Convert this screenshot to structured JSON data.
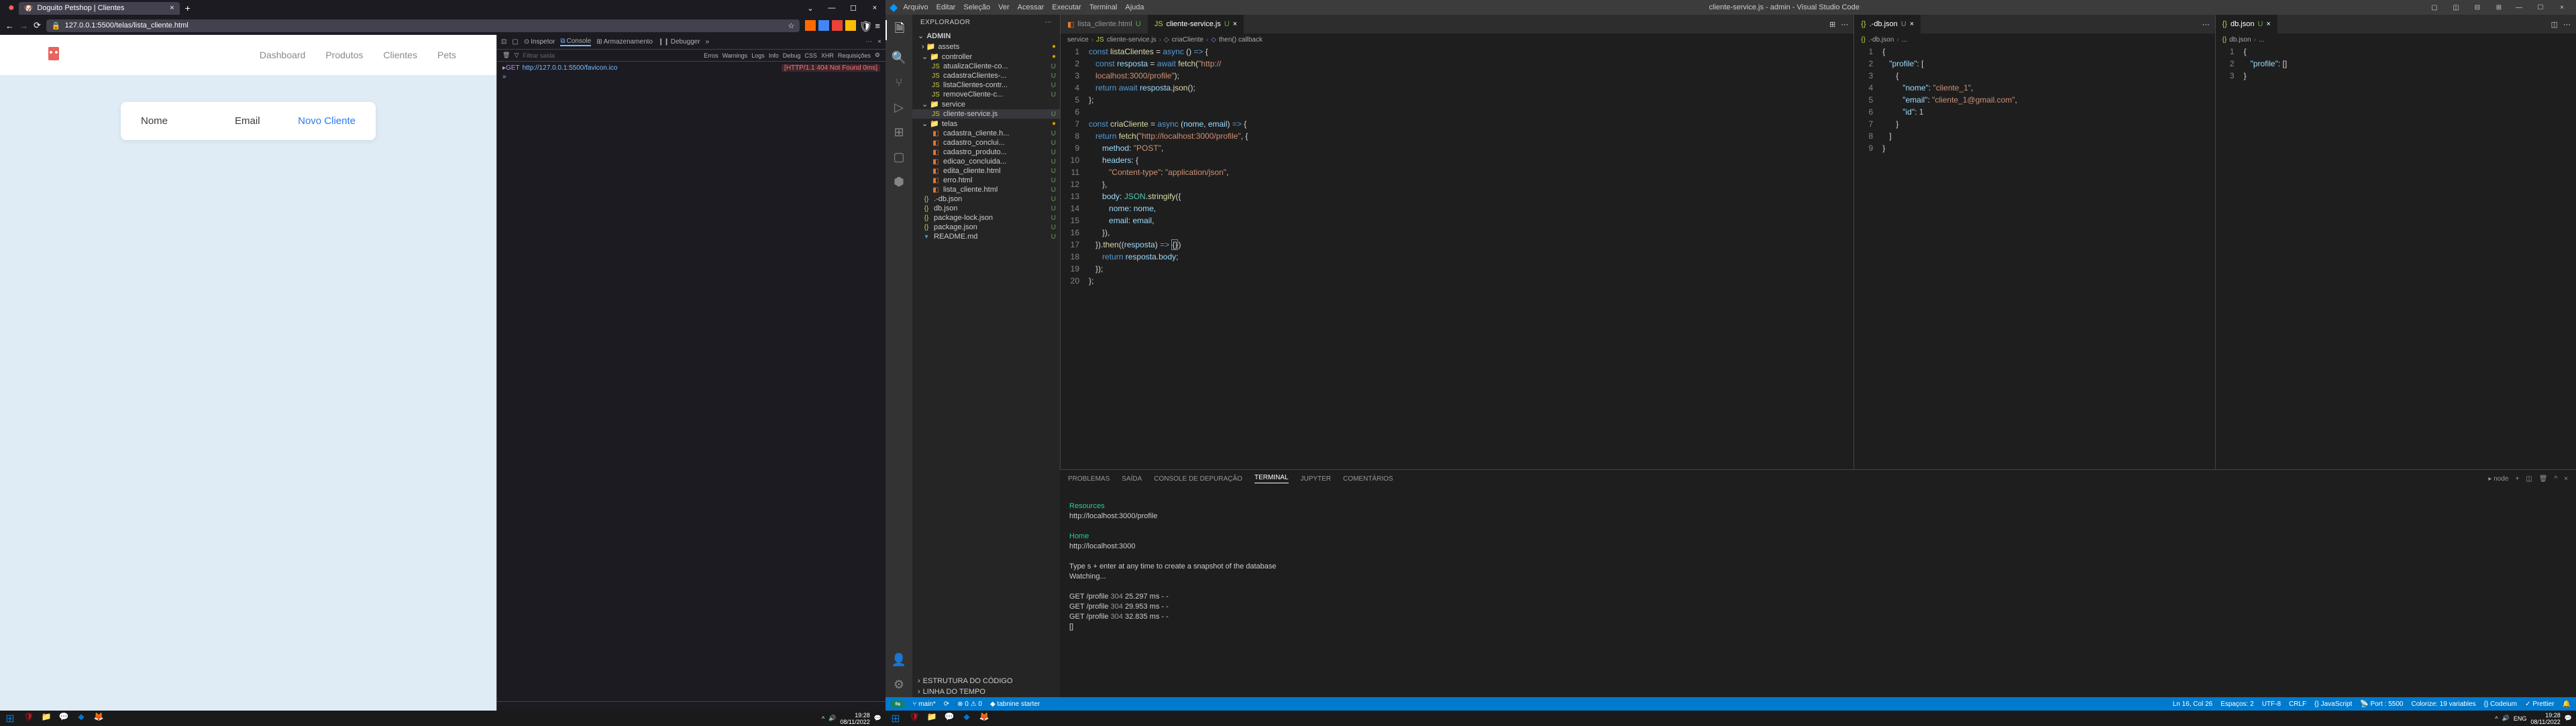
{
  "browser": {
    "tab_title": "Doguito Petshop | Clientes",
    "url_prefix_lock": "🔒",
    "url": "127.0.0.1:5500/telas/lista_cliente.html",
    "nav": {
      "dashboard": "Dashboard",
      "produtos": "Produtos",
      "clientes": "Clientes",
      "pets": "Pets"
    },
    "card": {
      "nome": "Nome",
      "email": "Email",
      "novo": "Novo Cliente"
    },
    "devtools": {
      "inspector": "Inspetor",
      "console": "Console",
      "armazenamento": "Armazenamento",
      "debugger": "Debugger",
      "toolbar_filter": "Filtrar saída",
      "toolbar_erros": "Erros",
      "toolbar_warnings": "Warnings",
      "toolbar_logs": "Logs",
      "toolbar_info": "Info",
      "toolbar_debug": "Debug",
      "toolbar_css": "CSS",
      "toolbar_xhr": "XHR",
      "toolbar_req": "Requisições",
      "row_method": "GET",
      "row_url": "http://127.0.0.1:5500/favicon.ico",
      "row_meta": "[HTTP/1.1 404 Not Found 0ms]"
    }
  },
  "vscode": {
    "title": "cliente-service.js - admin - Visual Studio Code",
    "menu": [
      "Arquivo",
      "Editar",
      "Seleção",
      "Ver",
      "Acessar",
      "Executar",
      "Terminal",
      "Ajuda"
    ],
    "explorer": "EXPLORADOR",
    "root": "ADMIN",
    "tree": {
      "assets_dot": "●",
      "assets": "assets",
      "controller_dot": "●",
      "controller": "controller",
      "f1": "atualizaCliente-co...",
      "f2": "cadastraClientes-...",
      "f3": "listaClientes-contr...",
      "f4": "removeCliente-c...",
      "service": "service",
      "f5": "cliente-service.js",
      "telas_dot": "●",
      "telas": "telas",
      "f6": "cadastra_cliente.h...",
      "f7": "cadastro_conclui...",
      "f8": "cadastro_produto...",
      "f9": "edicao_concluida...",
      "f10": "edita_cliente.html",
      "f11": "erro.html",
      "f12": "lista_cliente.html",
      "f13": ".-db.json",
      "f14": "db.json",
      "f15": "package-lock.json",
      "f16": "package.json",
      "f17": "README.md",
      "outline": "ESTRUTURA DO CÓDIGO",
      "timeline": "LINHA DO TEMPO"
    },
    "tabs": {
      "t1": "lista_cliente.html",
      "t2": "cliente-service.js",
      "t3": ".-db.json",
      "t4": "db.json"
    },
    "crumbs1": [
      "service",
      "cliente-service.js",
      "criaCliente",
      "then() callback"
    ],
    "crumbs2": [
      ".-db.json",
      "..."
    ],
    "crumbs3": [
      "db.json",
      "..."
    ],
    "code1": {
      "l1": "const listaClientes = async () => {",
      "l2": "   const resposta = await fetch(\"http://",
      "l3": "   localhost:3000/profile\");",
      "l4": "   return await resposta.json();",
      "l5": "};",
      "l6": "",
      "l7": "const criaCliente = async (nome, email) => {",
      "l8": "   return fetch(\"http://localhost:3000/profile\", {",
      "l9": "      method: \"POST\",",
      "l10": "      headers: {",
      "l11": "         \"Content-type\": \"application/json\",",
      "l12": "      },",
      "l13": "      body: JSON.stringify({",
      "l14": "         nome: nome,",
      "l15": "         email: email,",
      "l16": "      }),",
      "l17a": "   }).then((resposta) => ",
      "l17b": "{})",
      "l18": "      return resposta.body;",
      "l19": "   });",
      "l20": "};",
      "l21": ""
    },
    "code2": {
      "l1": "{",
      "l2": "   \"profile\": [",
      "l3": "      {",
      "l4": "         \"nome\": \"cliente_1\",",
      "l5": "         \"email\": \"cliente_1@gmail.com\",",
      "l6": "         \"id\": 1",
      "l7": "      }",
      "l8": "   ]",
      "l9": "}"
    },
    "code3": {
      "l1": "{",
      "l2": "   \"profile\": []",
      "l3": "}"
    },
    "panel": {
      "problemas": "PROBLEMAS",
      "saida": "SAÍDA",
      "console": "CONSOLE DE DEPURAÇÃO",
      "terminal": "TERMINAL",
      "jupyter": "JUPYTER",
      "comentarios": "COMENTÁRIOS",
      "node": "node"
    },
    "term": {
      "res": "Resources",
      "res_url": "http://localhost:3000/profile",
      "home": "Home",
      "home_url": "http://localhost:3000",
      "snap1": "Type s + enter at any time to create a snapshot of the database",
      "snap2": "Watching...",
      "g1a": "GET /profile ",
      "g1b": "304",
      "g1c": " 25.297 ms - -",
      "g2a": "GET /profile ",
      "g2b": "304",
      "g2c": " 29.953 ms - -",
      "g3a": "GET /profile ",
      "g3b": "304",
      "g3c": " 32.835 ms - -",
      "cursor": "[]"
    },
    "status": {
      "branch": "main*",
      "sync": "⟳",
      "err": "⊗ 0  ⚠ 0",
      "tabnine": "tabnine starter",
      "pos": "Ln 16, Col 26",
      "spaces": "Espaços: 2",
      "enc": "UTF-8",
      "eol": "CRLF",
      "lang": "JavaScript",
      "port": "Port : 5500",
      "colorize": "Colorize: 19 variables",
      "codeium": "Codeium",
      "prettier": "Prettier"
    }
  },
  "taskbar": {
    "time1": "19:28",
    "date1": "08/11/2022",
    "time2": "19:28",
    "date2": "08/11/2022",
    "lang": "ENG"
  }
}
